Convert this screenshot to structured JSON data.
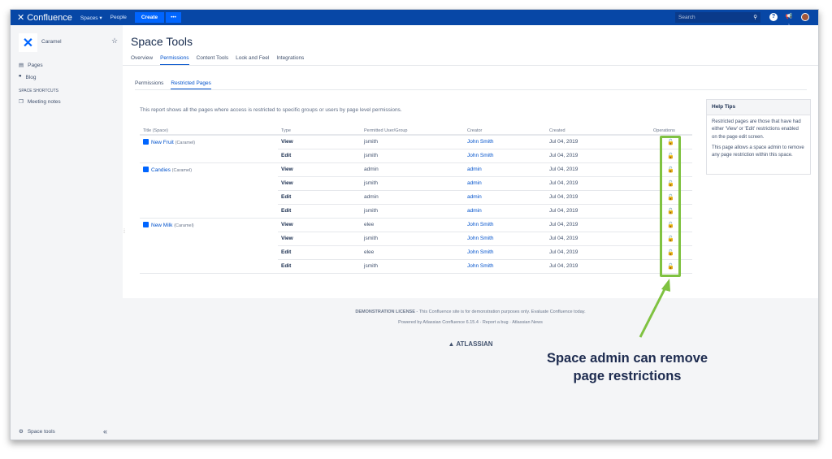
{
  "nav": {
    "brand": "Confluence",
    "spaces": "Spaces",
    "people": "People",
    "create": "Create",
    "more": "•••",
    "search_placeholder": "Search",
    "notifications_count": "1"
  },
  "sidebar": {
    "space_name": "Caramel",
    "pages": "Pages",
    "blog": "Blog",
    "shortcuts_heading": "SPACE SHORTCUTS",
    "meeting_notes": "Meeting notes",
    "space_tools": "Space tools",
    "collapse": "«"
  },
  "main": {
    "title": "Space Tools",
    "tabs": [
      "Overview",
      "Permissions",
      "Content Tools",
      "Look and Feel",
      "Integrations"
    ],
    "active_tab": "Permissions",
    "subtabs": [
      "Permissions",
      "Restricted Pages"
    ],
    "active_subtab": "Restricted Pages",
    "intro": "This report shows all the pages where access is restricted to specific groups or users by page level permissions."
  },
  "table": {
    "headers": [
      "Title (Space)",
      "Type",
      "Permitted User/Group",
      "Creator",
      "Created",
      "Operations"
    ],
    "rows": [
      {
        "title": "New Fruit",
        "space": "(Caramel)",
        "type": "View",
        "user": "jsmith",
        "creator": "John Smith",
        "created": "Jul 04, 2019"
      },
      {
        "title": "",
        "space": "",
        "type": "Edit",
        "user": "jsmith",
        "creator": "John Smith",
        "created": "Jul 04, 2019"
      },
      {
        "title": "Candies",
        "space": "(Caramel)",
        "type": "View",
        "user": "admin",
        "creator": "admin",
        "created": "Jul 04, 2019"
      },
      {
        "title": "",
        "space": "",
        "type": "View",
        "user": "jsmith",
        "creator": "admin",
        "created": "Jul 04, 2019"
      },
      {
        "title": "",
        "space": "",
        "type": "Edit",
        "user": "admin",
        "creator": "admin",
        "created": "Jul 04, 2019"
      },
      {
        "title": "",
        "space": "",
        "type": "Edit",
        "user": "jsmith",
        "creator": "admin",
        "created": "Jul 04, 2019"
      },
      {
        "title": "New Milk",
        "space": "(Caramel)",
        "type": "View",
        "user": "elee",
        "creator": "John Smith",
        "created": "Jul 04, 2019"
      },
      {
        "title": "",
        "space": "",
        "type": "View",
        "user": "jsmith",
        "creator": "John Smith",
        "created": "Jul 04, 2019"
      },
      {
        "title": "",
        "space": "",
        "type": "Edit",
        "user": "elee",
        "creator": "John Smith",
        "created": "Jul 04, 2019"
      },
      {
        "title": "",
        "space": "",
        "type": "Edit",
        "user": "jsmith",
        "creator": "John Smith",
        "created": "Jul 04, 2019"
      }
    ]
  },
  "help": {
    "title": "Help Tips",
    "p1": "Restricted pages are those that have had either 'View' or 'Edit' restrictions enabled on the page edit screen.",
    "p2": "This page allows a space admin to remove any page restriction within this space."
  },
  "footer": {
    "license_label": "DEMONSTRATION LICENSE",
    "license_text": " - This Confluence site is for demonstration purposes only. Evaluate Confluence today.",
    "powered": "Powered by Atlassian Confluence 6.15.4",
    "report_bug": "Report a bug",
    "news": "Atlassian News",
    "atlassian": "ATLASSIAN"
  },
  "annotation": {
    "line1": "Space admin can remove",
    "line2": "page restrictions",
    "color": "#7fc241"
  }
}
